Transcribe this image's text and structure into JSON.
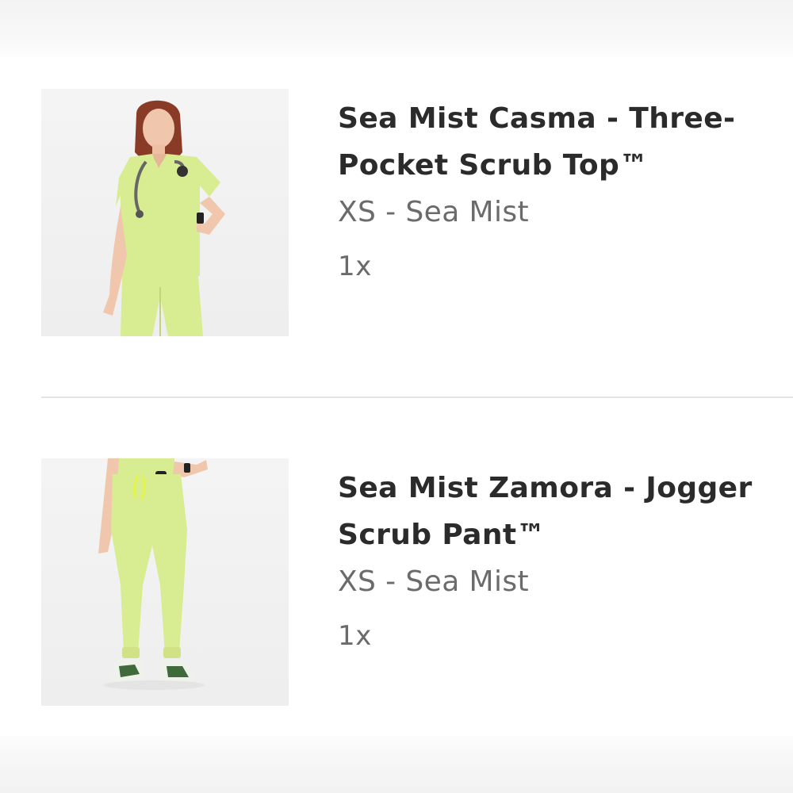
{
  "cart": {
    "items": [
      {
        "title": "Sea Mist Casma - Three-Pocket Scrub Top™",
        "variant": "XS - Sea Mist",
        "quantity": "1x",
        "image_icon": "scrub-top-product-image"
      },
      {
        "title": "Sea Mist Zamora - Jogger Scrub Pant™",
        "variant": "XS - Sea Mist",
        "quantity": "1x",
        "image_icon": "jogger-pant-product-image"
      }
    ]
  },
  "colors": {
    "product": "#d8ec91",
    "title_text": "#2b2b2b",
    "meta_text": "#6b6b6b",
    "divider": "#e3e3e3"
  }
}
